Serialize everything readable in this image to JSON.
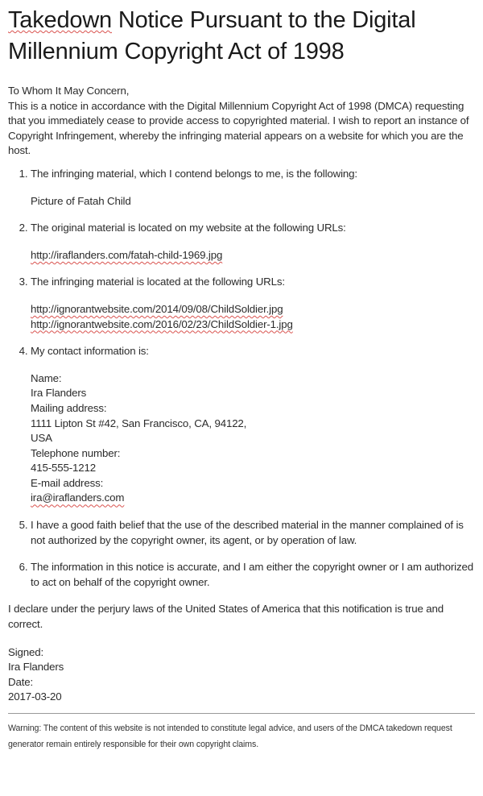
{
  "title": {
    "misspelled_word": "Takedown",
    "rest": " Notice Pursuant to the Digital Millennium Copyright Act of 1998"
  },
  "intro": {
    "salutation": "To Whom It May Concern,",
    "body": "This is a notice in accordance with the Digital Millennium Copyright Act of 1998 (DMCA) requesting that you immediately cease to provide access to copyrighted material. I wish to report an instance of Copyright Infringement, whereby the infringing material appears on a website for which you are the host."
  },
  "items": [
    {
      "text": "The infringing material, which I contend belongs to me, is the following:",
      "details": [
        "Picture of Fatah Child"
      ]
    },
    {
      "text": "The original material is located on my website at the following URLs:",
      "details": [
        "http://iraflanders.com/fatah-child-1969.jpg"
      ]
    },
    {
      "text": "The infringing material is located at the following URLs:",
      "details": [
        "http://ignorantwebsite.com/2014/09/08/ChildSoldier.jpg",
        "http://ignorantwebsite.com/2016/02/23/ChildSoldier-1.jpg"
      ]
    },
    {
      "text": "My contact information is:",
      "details": [
        "Name:",
        "Ira Flanders",
        "Mailing address:",
        "1111 Lipton St #42, San Francisco, CA, 94122,",
        "USA",
        "Telephone number:",
        "415-555-1212",
        "E-mail address:",
        "ira@iraflanders.com"
      ]
    },
    {
      "text": "I have a good faith belief that the use of the described material in the manner complained of is not authorized by the copyright owner, its agent, or by operation of law.",
      "details": []
    },
    {
      "text": "The information in this notice is accurate, and I am either the copyright owner or I am authorized to act on behalf of the copyright owner.",
      "details": []
    }
  ],
  "declaration": "I declare under the perjury laws of the United States of America that this notification is true and correct.",
  "signature": {
    "signed_label": "Signed:",
    "signed_name": "Ira Flanders",
    "date_label": "Date:",
    "date_value": "2017-03-20"
  },
  "warning": "Warning: The content of this website is not intended to constitute legal advice, and users of the DMCA takedown request generator remain entirely responsible for their own copyright claims.",
  "colors": {
    "text": "#2b2b2b",
    "spellcheck_underline": "#d9534f",
    "rule": "#9a9a9a"
  }
}
